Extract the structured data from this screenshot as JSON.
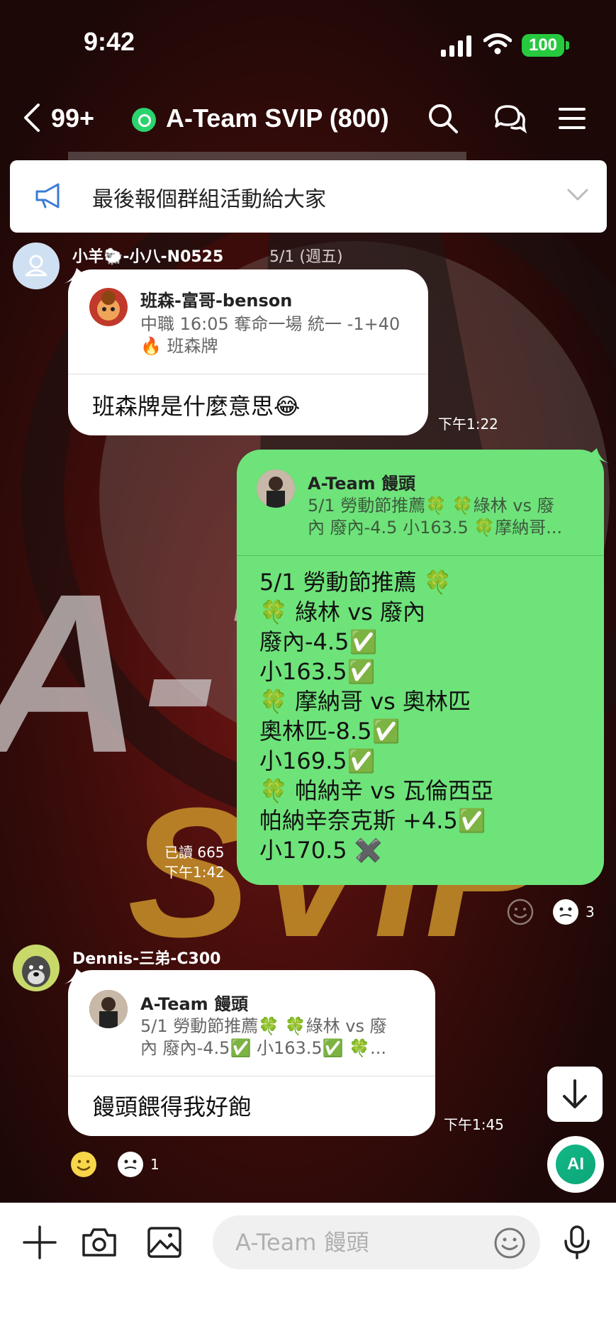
{
  "status_bar": {
    "time": "9:42",
    "battery": "100"
  },
  "header": {
    "back_count": "99+",
    "title": "A-Team SVIP (800)",
    "icons": [
      "search-icon",
      "chat-bubbles-icon",
      "menu-icon"
    ]
  },
  "announcement": {
    "text": "最後報個群組活動給大家"
  },
  "messages": [
    {
      "sender": "小羊🐑-小八-N0525",
      "date": "5/1 (週五)",
      "reply": {
        "name": "班森-富哥-benson",
        "text_line1": "中職 16:05 奪命一場 統一 -1+40",
        "text_line2": "🔥 班森牌"
      },
      "text": "班森牌是什麼意思😂",
      "time": "下午1:22"
    },
    {
      "sender": "A-Team 饅頭",
      "reply": {
        "name": "A-Team 饅頭",
        "text_line1": "5/1 勞動節推薦🍀 🍀綠林 vs 廢",
        "text_line2": "內 廢內-4.5 小163.5 🍀摩納哥..."
      },
      "lines": [
        "5/1 勞動節推薦 🍀",
        "🍀 綠林 vs 廢內",
        "廢內-4.5✅",
        "小163.5✅",
        "🍀 摩納哥 vs 奧林匹",
        " 奧林匹-8.5✅",
        "小169.5✅",
        "🍀 帕納辛 vs 瓦倫西亞",
        "帕納辛奈克斯 +4.5✅",
        "小170.5 ✖️"
      ],
      "read": "已讀 665",
      "time": "下午1:42",
      "reaction_count": "3"
    },
    {
      "sender": "Dennis-三弟-C300",
      "reply": {
        "name": "A-Team 饅頭",
        "text_line1": "5/1 勞動節推薦🍀 🍀綠林 vs 廢",
        "text_line2": "內 廢內-4.5✅ 小163.5✅ 🍀..."
      },
      "text": "饅頭餵得我好飽",
      "time": "下午1:45",
      "reaction_count": "1"
    }
  ],
  "input": {
    "placeholder": "A-Team 饅頭"
  },
  "ai_button": "AI"
}
